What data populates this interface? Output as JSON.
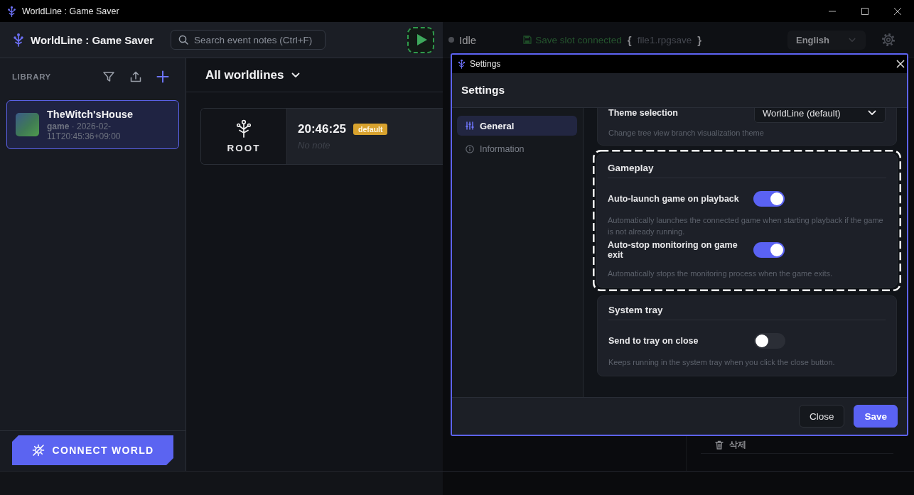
{
  "window": {
    "title": "WorldLine : Game Saver"
  },
  "header": {
    "app_name": "WorldLine : Game Saver",
    "search": {
      "placeholder": "Search event notes (Ctrl+F)"
    },
    "status": "Idle",
    "save_slot": {
      "label": "Save slot connected",
      "open_brace": "{",
      "file": "file1.rpgsave",
      "close_brace": "}"
    },
    "language": "English"
  },
  "sidebar": {
    "title": "LIBRARY",
    "games": [
      {
        "title": "TheWitch'sHouse",
        "meta": "**game** · 2026-02-11T20:45:36+09:00",
        "selected": true
      }
    ],
    "connect_button": "CONNECT WORLD"
  },
  "main": {
    "filter": "All worldlines",
    "nodes": [
      {
        "kind": "root",
        "label": "ROOT",
        "time": "20:46:25",
        "badge": "default",
        "note": "No note"
      }
    ]
  },
  "detail_panel": {
    "delete_label": "삭제"
  },
  "settings_dialog": {
    "window_title": "Settings",
    "title": "Settings",
    "nav": [
      {
        "kind": "general",
        "label": "General",
        "selected": true
      },
      {
        "kind": "info",
        "label": "Information",
        "selected": false
      }
    ],
    "sections": [
      {
        "highlighted": false,
        "rows": [
          {
            "kind": "select",
            "label": "Theme selection",
            "value": "WorldLine (default)",
            "description": "Change tree view branch visualization theme"
          }
        ]
      },
      {
        "title": "Gameplay",
        "highlighted": true,
        "rows": [
          {
            "kind": "toggle",
            "label": "Auto-launch game on playback",
            "on": true,
            "description": "Automatically launches the connected game when starting playback if the game is not already running."
          },
          {
            "kind": "toggle",
            "label": "Auto-stop monitoring on game exit",
            "on": true,
            "description": "Automatically stops the monitoring process when the game exits."
          }
        ]
      },
      {
        "title": "System tray",
        "highlighted": false,
        "rows": [
          {
            "kind": "toggle",
            "label": "Send to tray on close",
            "on": false,
            "description": "Keeps running in the system tray when you click the close button."
          }
        ]
      }
    ],
    "buttons": [
      {
        "kind": "secondary",
        "label": "Close"
      },
      {
        "kind": "primary",
        "label": "Save"
      }
    ]
  }
}
